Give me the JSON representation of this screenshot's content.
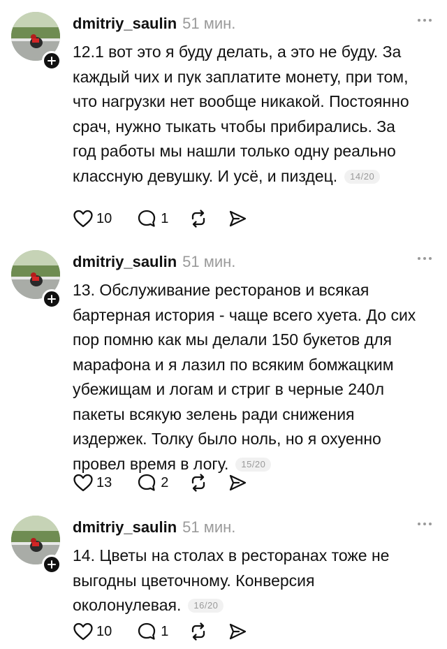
{
  "posts": [
    {
      "username": "dmitriy_saulin",
      "time": "51 мин.",
      "text": "12.1 вот это я буду делать, а это не буду. За каждый чих и пук заплатите монету, при том, что нагрузки нет вообще никакой. Постоянно срач, нужно тыкать чтобы прибирались. За год работы мы нашли только одну реально классную девушку. И усё, и пиздец.",
      "counter": "14/20",
      "likes": "10",
      "replies": "1"
    },
    {
      "username": "dmitriy_saulin",
      "time": "51 мин.",
      "text": "13. Обслуживание ресторанов и всякая бартерная история - чаще всего хуета. До сих пор помню как мы делали 150 букетов для марафона и я лазил по всяким бомжацким убежищам и логам и стриг в черные 240л пакеты всякую зелень ради снижения издержек. Толку было ноль, но я охуенно провел время в логу.",
      "counter": "15/20",
      "likes": "13",
      "replies": "2"
    },
    {
      "username": "dmitriy_saulin",
      "time": "51 мин.",
      "text": "14. Цветы на столах в ресторанах тоже не выгодны цветочному. Конверсия околонулевая.",
      "counter": "16/20",
      "likes": "10",
      "replies": "1"
    }
  ],
  "icons": {
    "like": "heart-icon",
    "reply": "comment-icon",
    "repost": "repost-icon",
    "share": "send-icon",
    "more": "more-icon",
    "follow": "plus-icon"
  }
}
